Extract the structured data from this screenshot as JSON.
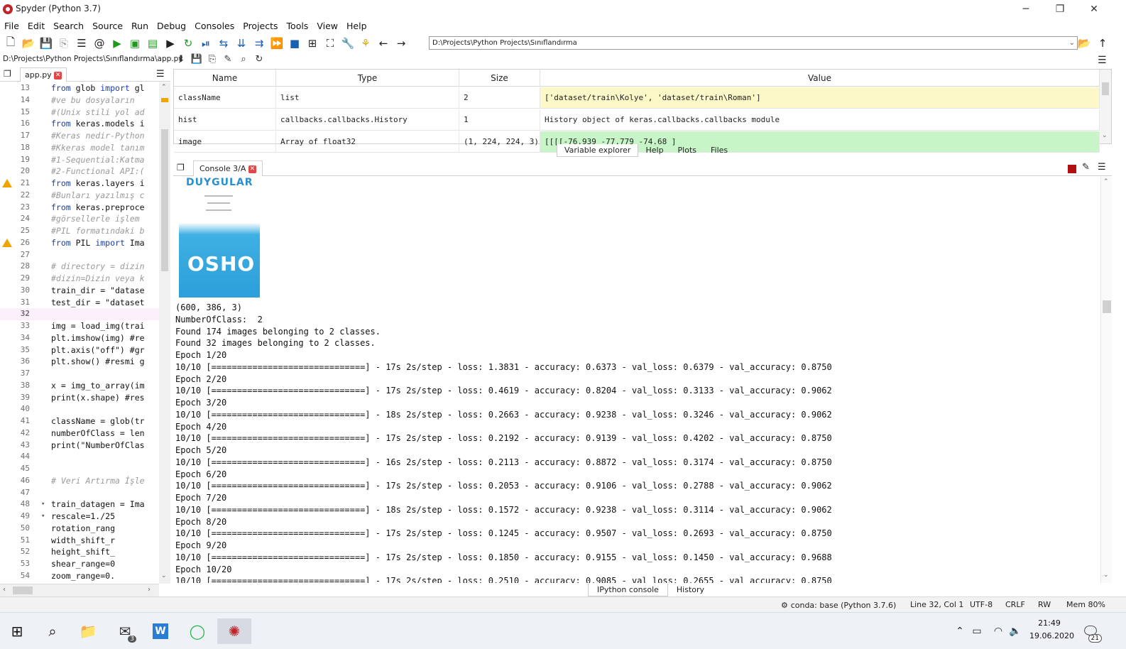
{
  "window": {
    "title": "Spyder (Python 3.7)",
    "minimize": "─",
    "restore": "❐",
    "close": "✕"
  },
  "menu": [
    "File",
    "Edit",
    "Search",
    "Source",
    "Run",
    "Debug",
    "Consoles",
    "Projects",
    "Tools",
    "View",
    "Help"
  ],
  "toolbar": {
    "icons": [
      "new-file-icon",
      "open-folder-icon",
      "save-icon",
      "save-all-icon",
      "browse-tabs-icon",
      "at-icon",
      "run-icon",
      "run-cell-icon",
      "run-cell-advance-icon",
      "run-selection-icon",
      "rerun-icon",
      "debug-icon",
      "step-icon",
      "step-into-icon",
      "step-return-icon",
      "continue-icon",
      "stop-icon",
      "maximize-pane-icon",
      "fullscreen-icon",
      "preferences-icon",
      "python-path-icon",
      "back-arrow-icon",
      "forward-arrow-icon"
    ],
    "working_dir": "D:\\Projects\\Python Projects\\Sınıflandırma"
  },
  "editor": {
    "file_path": "D:\\Projects\\Python Projects\\Sınıflandırma\\app.py",
    "tab_label": "app.py",
    "lines": [
      {
        "n": "13",
        "code": "from glob import gl"
      },
      {
        "n": "14",
        "code": "#ve bu dosyaların",
        "comment": true
      },
      {
        "n": "15",
        "code": "#(Unix stili yol ad",
        "comment": true
      },
      {
        "n": "16",
        "code": "from keras.models i"
      },
      {
        "n": "17",
        "code": "#Keras nedir-Python",
        "comment": true
      },
      {
        "n": "18",
        "code": "#Kkeras model tanım",
        "comment": true
      },
      {
        "n": "19",
        "code": "#1-Sequential:Katma",
        "comment": true
      },
      {
        "n": "20",
        "code": "#2-Functional API:(",
        "comment": true
      },
      {
        "n": "21",
        "code": "from keras.layers i",
        "warn": true
      },
      {
        "n": "22",
        "code": "#Bunları yazılmış c",
        "comment": true
      },
      {
        "n": "23",
        "code": "from keras.preproce"
      },
      {
        "n": "24",
        "code": "#görsellerle işlem",
        "comment": true
      },
      {
        "n": "25",
        "code": "#PIL formatındaki b",
        "comment": true
      },
      {
        "n": "26",
        "code": "from PIL import Ima",
        "warn": true
      },
      {
        "n": "27",
        "code": ""
      },
      {
        "n": "28",
        "code": "# directory = dizin",
        "comment": true
      },
      {
        "n": "29",
        "code": "#dizin=Dizin veya k",
        "comment": true
      },
      {
        "n": "30",
        "code": "train_dir = \"datase"
      },
      {
        "n": "31",
        "code": "test_dir = \"dataset"
      },
      {
        "n": "32",
        "code": "",
        "current": true
      },
      {
        "n": "33",
        "code": "img = load_img(trai"
      },
      {
        "n": "34",
        "code": "plt.imshow(img) #re"
      },
      {
        "n": "35",
        "code": "plt.axis(\"off\") #gr"
      },
      {
        "n": "36",
        "code": "plt.show() #resmi g"
      },
      {
        "n": "37",
        "code": ""
      },
      {
        "n": "38",
        "code": "x = img_to_array(im"
      },
      {
        "n": "39",
        "code": "print(x.shape) #res"
      },
      {
        "n": "40",
        "code": ""
      },
      {
        "n": "41",
        "code": "className = glob(tr"
      },
      {
        "n": "42",
        "code": "numberOfClass = len"
      },
      {
        "n": "43",
        "code": "print(\"NumberOfClas"
      },
      {
        "n": "44",
        "code": ""
      },
      {
        "n": "45",
        "code": ""
      },
      {
        "n": "46",
        "code": "# Veri Artırma İşle",
        "comment": true
      },
      {
        "n": "47",
        "code": ""
      },
      {
        "n": "48",
        "code": "train_datagen = Ima",
        "fold": true
      },
      {
        "n": "49",
        "code": "    rescale=1./25",
        "fold": true
      },
      {
        "n": "50",
        "code": "    rotation_rang"
      },
      {
        "n": "51",
        "code": "    width_shift_r"
      },
      {
        "n": "52",
        "code": "    height_shift_"
      },
      {
        "n": "53",
        "code": "    shear_range=0"
      },
      {
        "n": "54",
        "code": "    zoom_range=0."
      }
    ]
  },
  "variable_explorer": {
    "headers": [
      "Name",
      "Type",
      "Size",
      "Value"
    ],
    "rows": [
      {
        "name": "className",
        "type": "list",
        "size": "2",
        "value": "['dataset/train\\Kolye', 'dataset/train\\Roman']",
        "color": "#fdf8c8"
      },
      {
        "name": "hist",
        "type": "callbacks.callbacks.History",
        "size": "1",
        "value": "History object of keras.callbacks.callbacks module",
        "color": "#ffffff"
      },
      {
        "name": "image",
        "type": "Array of float32",
        "size": "(1, 224, 224, 3)",
        "value": "[[[[-76.939      -77.779      -74.68      ]",
        "color": "#c8f5c8"
      }
    ],
    "tabs": [
      "Variable explorer",
      "Help",
      "Plots",
      "Files"
    ]
  },
  "console": {
    "tab_label": "Console 3/A",
    "book": {
      "title": "DUYGULAR",
      "author": "OSHO"
    },
    "lines": [
      "(600, 386, 3)",
      "NumberOfClass:  2",
      "Found 174 images belonging to 2 classes.",
      "Found 32 images belonging to 2 classes.",
      "Epoch 1/20",
      "10/10 [==============================] - 17s 2s/step - loss: 1.3831 - accuracy: 0.6373 - val_loss: 0.6379 - val_accuracy: 0.8750",
      "Epoch 2/20",
      "10/10 [==============================] - 17s 2s/step - loss: 0.4619 - accuracy: 0.8204 - val_loss: 0.3133 - val_accuracy: 0.9062",
      "Epoch 3/20",
      "10/10 [==============================] - 18s 2s/step - loss: 0.2663 - accuracy: 0.9238 - val_loss: 0.3246 - val_accuracy: 0.9062",
      "Epoch 4/20",
      "10/10 [==============================] - 17s 2s/step - loss: 0.2192 - accuracy: 0.9139 - val_loss: 0.4202 - val_accuracy: 0.8750",
      "Epoch 5/20",
      "10/10 [==============================] - 16s 2s/step - loss: 0.2113 - accuracy: 0.8872 - val_loss: 0.3174 - val_accuracy: 0.8750",
      "Epoch 6/20",
      "10/10 [==============================] - 17s 2s/step - loss: 0.2053 - accuracy: 0.9106 - val_loss: 0.2788 - val_accuracy: 0.9062",
      "Epoch 7/20",
      "10/10 [==============================] - 18s 2s/step - loss: 0.1572 - accuracy: 0.9238 - val_loss: 0.3114 - val_accuracy: 0.9062",
      "Epoch 8/20",
      "10/10 [==============================] - 17s 2s/step - loss: 0.1245 - accuracy: 0.9507 - val_loss: 0.2693 - val_accuracy: 0.8750",
      "Epoch 9/20",
      "10/10 [==============================] - 17s 2s/step - loss: 0.1850 - accuracy: 0.9155 - val_loss: 0.1450 - val_accuracy: 0.9688",
      "Epoch 10/20",
      "10/10 [==============================] - 17s 2s/step - loss: 0.2510 - accuracy: 0.9085 - val_loss: 0.2655 - val_accuracy: 0.8750"
    ],
    "bottom_tabs": [
      "IPython console",
      "History"
    ]
  },
  "status": {
    "conda": "conda: base (Python 3.7.6)",
    "position": "Line 32, Col 1",
    "encoding": "UTF-8",
    "eol": "CRLF",
    "permissions": "RW",
    "memory": "Mem 80%"
  },
  "taskbar": {
    "time": "21:49",
    "date": "19.06.2020",
    "mail_badge": "3",
    "notification_badge": "21"
  }
}
